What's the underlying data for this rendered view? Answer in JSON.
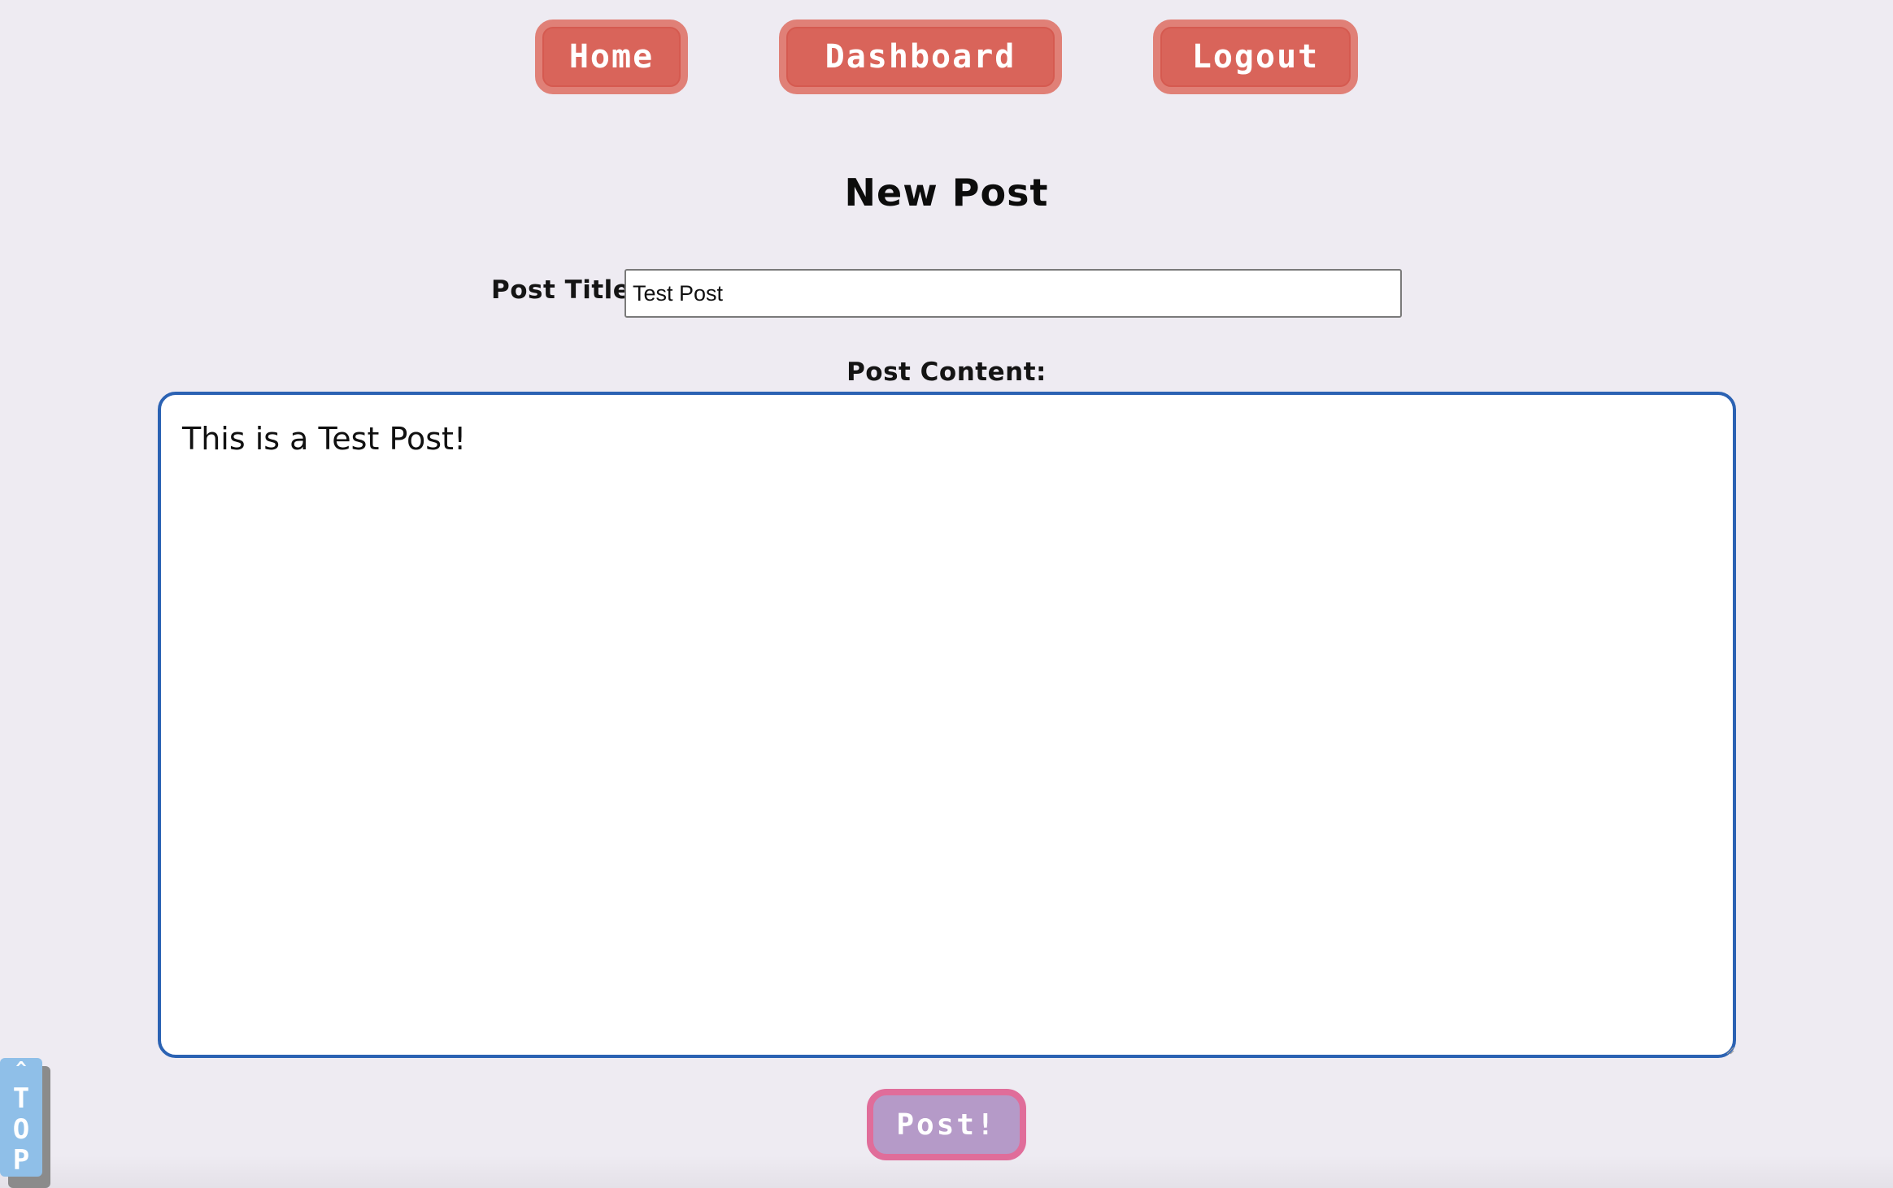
{
  "nav": {
    "home_label": "Home",
    "dashboard_label": "Dashboard",
    "logout_label": "Logout"
  },
  "page": {
    "title": "New Post"
  },
  "form": {
    "title_label": "Post Title:",
    "title_value": "Test Post",
    "content_label": "Post Content:",
    "content_value": "This is a Test Post!",
    "submit_label": "Post!"
  },
  "back_to_top": {
    "arrow": "^",
    "label": "TOP"
  },
  "colors": {
    "background": "#eeebf2",
    "nav_button": "#d9645a",
    "nav_button_border": "#e08077",
    "submit_button": "#b59ac8",
    "submit_button_border": "#e06d9a",
    "textarea_border": "#2b62b3",
    "top_button": "#8fbfe8"
  }
}
